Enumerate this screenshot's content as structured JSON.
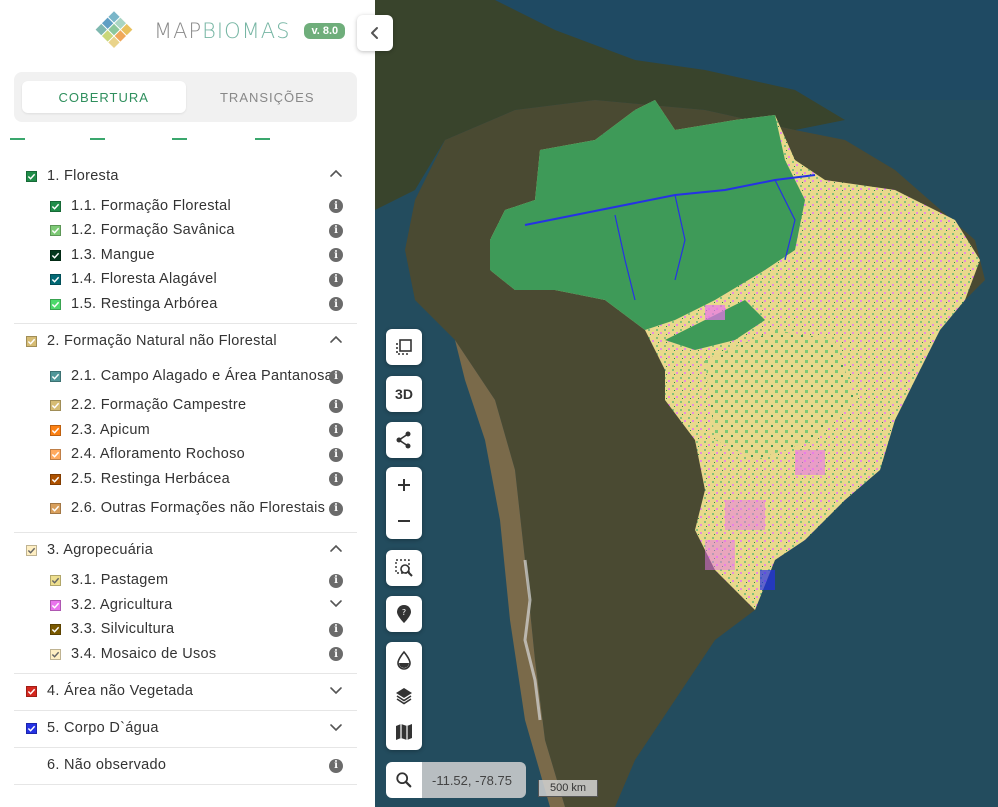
{
  "brand": {
    "name_part1": "MAP",
    "name_part2": "BIOMAS",
    "version": "v. 8.0"
  },
  "tabs": [
    {
      "label": "COBERTURA",
      "active": true
    },
    {
      "label": "TRANSIÇÕES",
      "active": false
    }
  ],
  "legend": [
    {
      "label": "1. Floresta",
      "color": "#1f8d49",
      "checked": true,
      "expanded": true,
      "items": [
        {
          "label": "1.1. Formação Florestal",
          "color": "#1f8d49"
        },
        {
          "label": "1.2. Formação Savânica",
          "color": "#7dc975"
        },
        {
          "label": "1.3. Mangue",
          "color": "#04381d"
        },
        {
          "label": "1.4. Floresta Alagável",
          "color": "#026975"
        },
        {
          "label": "1.5. Restinga Arbórea",
          "color": "#4dd96b"
        }
      ]
    },
    {
      "label": "2. Formação Natural não Florestal",
      "color": "#d6bc74",
      "checked": true,
      "expanded": true,
      "items": [
        {
          "label": "2.1. Campo Alagado e Área Pantanosa",
          "color": "#519799"
        },
        {
          "label": "2.2. Formação Campestre",
          "color": "#d6bc74"
        },
        {
          "label": "2.3. Apicum",
          "color": "#fc8114"
        },
        {
          "label": "2.4. Afloramento Rochoso",
          "color": "#ffaa5f"
        },
        {
          "label": "2.5. Restinga Herbácea",
          "color": "#ad5100"
        },
        {
          "label": "2.6. Outras Formações não Florestais",
          "color": "#d89f5c"
        }
      ]
    },
    {
      "label": "3. Agropecuária",
      "color": "#ffefc3",
      "checked": true,
      "expanded": true,
      "items": [
        {
          "label": "3.1. Pastagem",
          "color": "#edde8e",
          "control": "info"
        },
        {
          "label": "3.2. Agricultura",
          "color": "#e974ed",
          "control": "chevron"
        },
        {
          "label": "3.3. Silvicultura",
          "color": "#7a5900",
          "control": "info"
        },
        {
          "label": "3.4. Mosaico de Usos",
          "color": "#ffefc3",
          "control": "info"
        }
      ]
    },
    {
      "label": "4. Área não Vegetada",
      "color": "#d4271e",
      "checked": true,
      "expanded": false,
      "items": []
    },
    {
      "label": "5. Corpo D`água",
      "color": "#2532e4",
      "checked": true,
      "expanded": false,
      "items": []
    },
    {
      "label": "6. Não observado",
      "color": "#ffffff",
      "checked": false,
      "expanded": false,
      "items": [],
      "control": "info"
    }
  ],
  "map": {
    "controls": {
      "three_d_label": "3D"
    },
    "coordinates": "-11.52, -78.75",
    "scale": "500 km"
  },
  "icons": {
    "collapse": "chevron-left-icon",
    "info": "info-icon",
    "expand": "chevron-down-icon",
    "collapse_group": "chevron-up-icon"
  }
}
